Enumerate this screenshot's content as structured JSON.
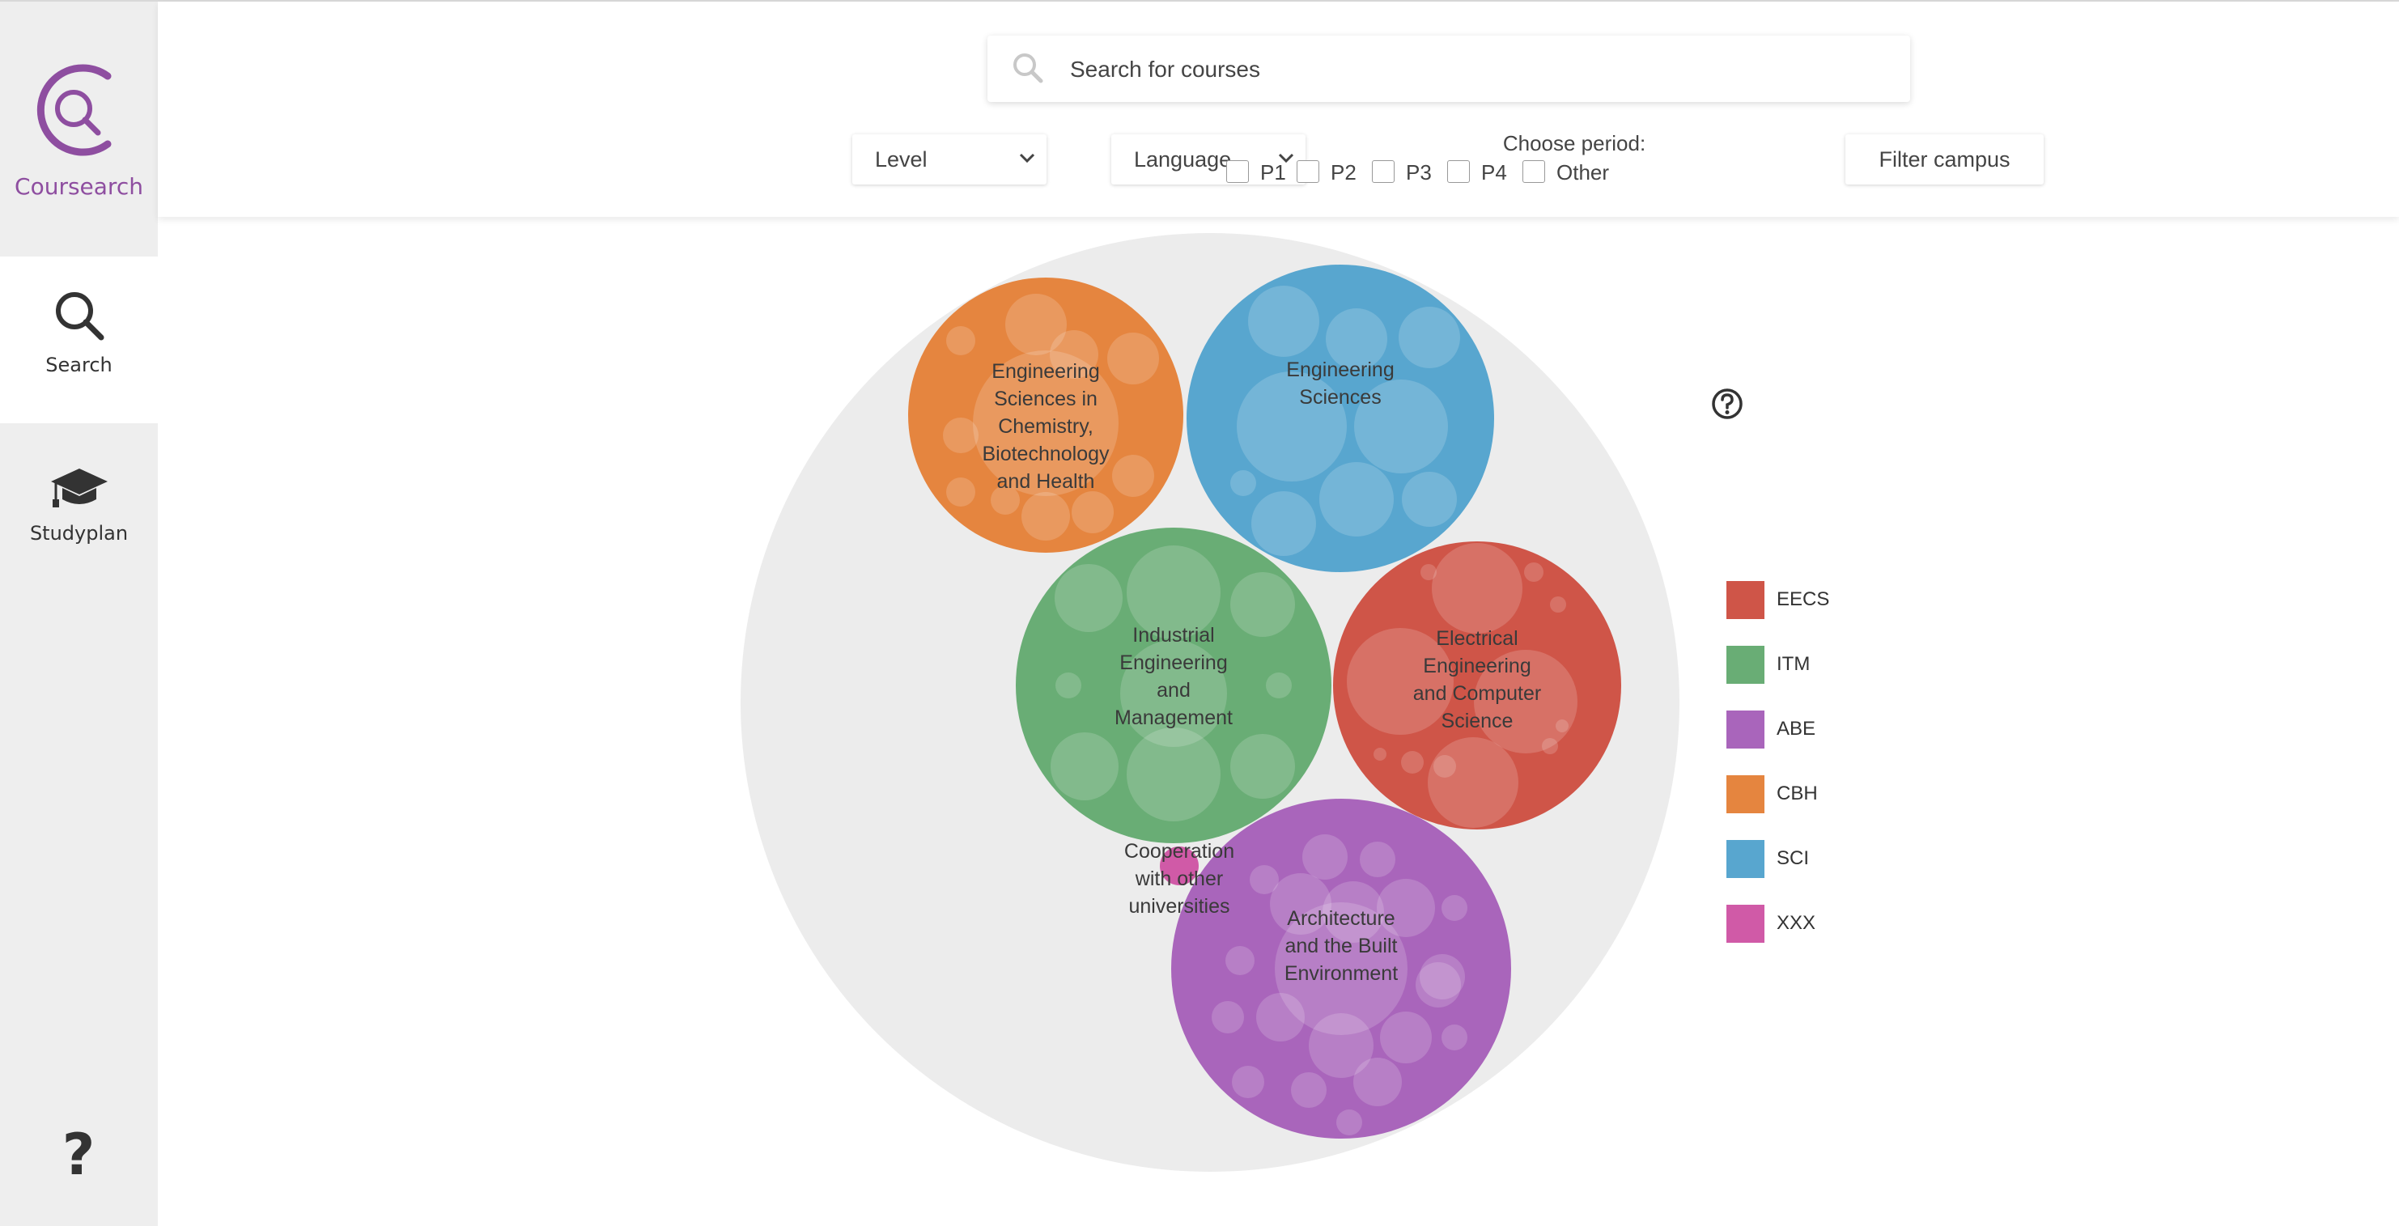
{
  "app": {
    "name": "Coursearch"
  },
  "sidebar": {
    "items": [
      {
        "label": "Search",
        "icon": "search-icon",
        "active": true
      },
      {
        "label": "Studyplan",
        "icon": "graduation-cap-icon",
        "active": false
      }
    ],
    "help_icon": "question-icon"
  },
  "header": {
    "search": {
      "placeholder": "Search for courses",
      "value": ""
    },
    "level_select": {
      "label": "Level"
    },
    "language_select": {
      "label": "Language"
    },
    "period": {
      "title": "Choose period:",
      "options": [
        {
          "label": "P1",
          "checked": false
        },
        {
          "label": "P2",
          "checked": false
        },
        {
          "label": "P3",
          "checked": false
        },
        {
          "label": "P4",
          "checked": false
        },
        {
          "label": "Other",
          "checked": false
        }
      ]
    },
    "filter_campus_label": "Filter campus"
  },
  "colors": {
    "brand": "#8e4ea0",
    "outer_circle": "#ececec",
    "EECS": "#cf5548",
    "ITM": "#69ad75",
    "ABE": "#a965bb",
    "CBH": "#e5853f",
    "SCI": "#58a6cf",
    "XXX": "#d05aa7"
  },
  "legend": [
    {
      "code": "EECS",
      "color": "#cf5548"
    },
    {
      "code": "ITM",
      "color": "#69ad75"
    },
    {
      "code": "ABE",
      "color": "#a965bb"
    },
    {
      "code": "CBH",
      "color": "#e5853f"
    },
    {
      "code": "SCI",
      "color": "#58a6cf"
    },
    {
      "code": "XXX",
      "color": "#d05aa7"
    }
  ],
  "schools": [
    {
      "code": "CBH",
      "name": [
        "Engineering",
        "Sciences in",
        "Chemistry,",
        "Biotechnology",
        "and Health"
      ]
    },
    {
      "code": "SCI",
      "name": [
        "Engineering",
        "Sciences"
      ]
    },
    {
      "code": "ITM",
      "name": [
        "Industrial",
        "Engineering",
        "and",
        "Management"
      ]
    },
    {
      "code": "EECS",
      "name": [
        "Electrical",
        "Engineering",
        "and Computer",
        "Science"
      ]
    },
    {
      "code": "ABE",
      "name": [
        "Architecture",
        "and the Built",
        "Environment"
      ]
    },
    {
      "code": "XXX",
      "name": [
        "Cooperation",
        "with other",
        "universities"
      ]
    }
  ]
}
